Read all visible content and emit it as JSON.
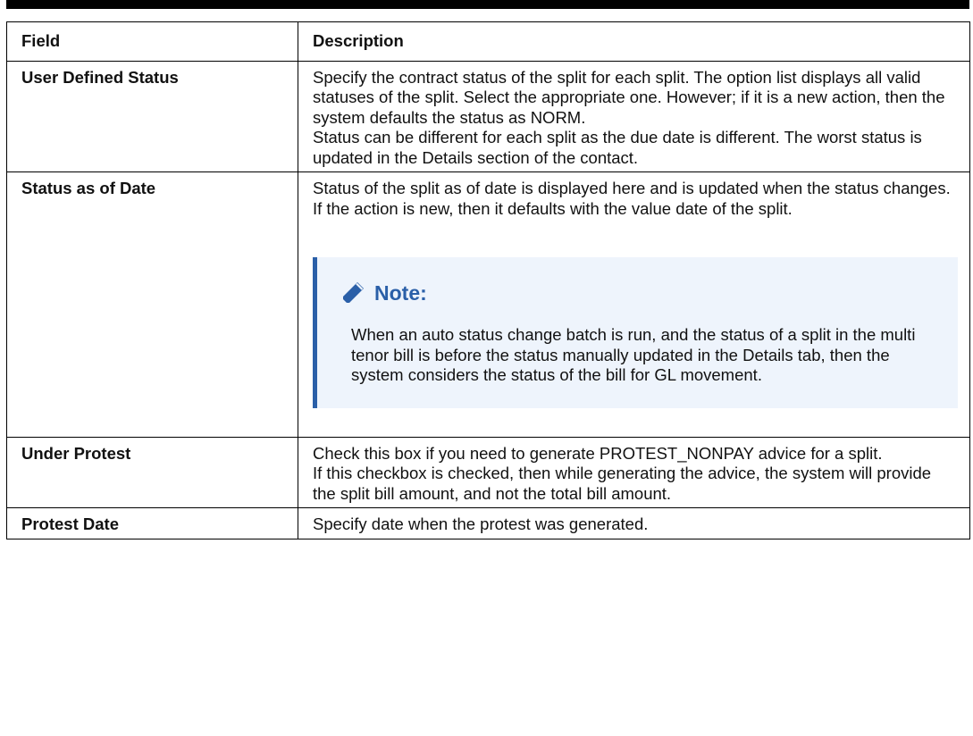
{
  "table": {
    "headers": {
      "field": "Field",
      "description": "Description"
    },
    "rows": [
      {
        "field": "User Defined Status",
        "lines": [
          "Specify the contract status of the split for each split. The option list displays all valid statuses of the split. Select the appropriate one. However; if it is a new action, then the system defaults the status as NORM.",
          "Status can be different for each split as the due date is different. The worst status is updated in the Details section of the contact."
        ]
      },
      {
        "field": "Status as of Date",
        "lines": [
          "Status of the split as of date is displayed here and is updated when the status changes. If the action is new, then it defaults with the value date of the split."
        ],
        "note": {
          "icon": "pencil-icon",
          "title": "Note:",
          "text": "When an auto status change batch is run, and the status of a split in the multi tenor bill is before the status manually updated in the Details tab, then the system considers the status of the bill for GL movement."
        }
      },
      {
        "field": "Under Protest",
        "lines": [
          "Check this box if you need to generate PROTEST_NONPAY advice for a split.",
          "If this checkbox is checked, then while generating the advice, the system will provide the split bill amount, and not the total bill amount."
        ]
      },
      {
        "field": "Protest Date",
        "lines": [
          "Specify date when the protest was generated."
        ]
      }
    ]
  },
  "colors": {
    "note_accent": "#2a5fa8",
    "note_background": "#eef4fc"
  }
}
